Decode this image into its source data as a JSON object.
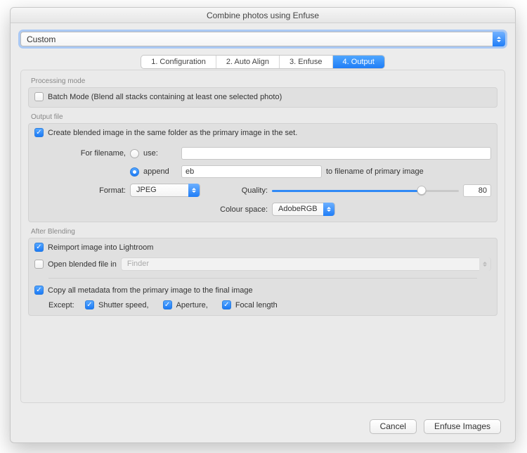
{
  "window": {
    "title": "Combine photos using Enfuse"
  },
  "preset": {
    "value": "Custom"
  },
  "tabs": {
    "t1": "1. Configuration",
    "t2": "2. Auto Align",
    "t3": "3. Enfuse",
    "t4": "4. Output"
  },
  "processing": {
    "section_label": "Processing mode",
    "batch_label": "Batch Mode (Blend all stacks containing at least one selected photo)",
    "batch_checked": false
  },
  "output_file": {
    "section_label": "Output file",
    "create_label": "Create blended image in the same folder as the primary image in the set.",
    "create_checked": true,
    "filename_label": "For filename,",
    "radio_use_label": "use:",
    "radio_use_selected": false,
    "use_value": "",
    "radio_append_label": "append",
    "radio_append_selected": true,
    "append_value": "eb",
    "append_suffix": "to filename of primary image",
    "format_label": "Format:",
    "format_value": "JPEG",
    "quality_label": "Quality:",
    "quality_value": "80",
    "colourspace_label": "Colour space:",
    "colourspace_value": "AdobeRGB"
  },
  "after_blending": {
    "section_label": "After Blending",
    "reimport_label": "Reimport image into Lightroom",
    "reimport_checked": true,
    "open_label": "Open blended file in",
    "open_checked": false,
    "open_app": "Finder",
    "copy_meta_label": "Copy all metadata from the primary image to the final image",
    "copy_meta_checked": true,
    "except_label": "Except:",
    "shutter_label": "Shutter speed,",
    "shutter_checked": true,
    "aperture_label": "Aperture,",
    "aperture_checked": true,
    "focal_label": "Focal length",
    "focal_checked": true
  },
  "buttons": {
    "cancel": "Cancel",
    "enfuse": "Enfuse Images"
  }
}
